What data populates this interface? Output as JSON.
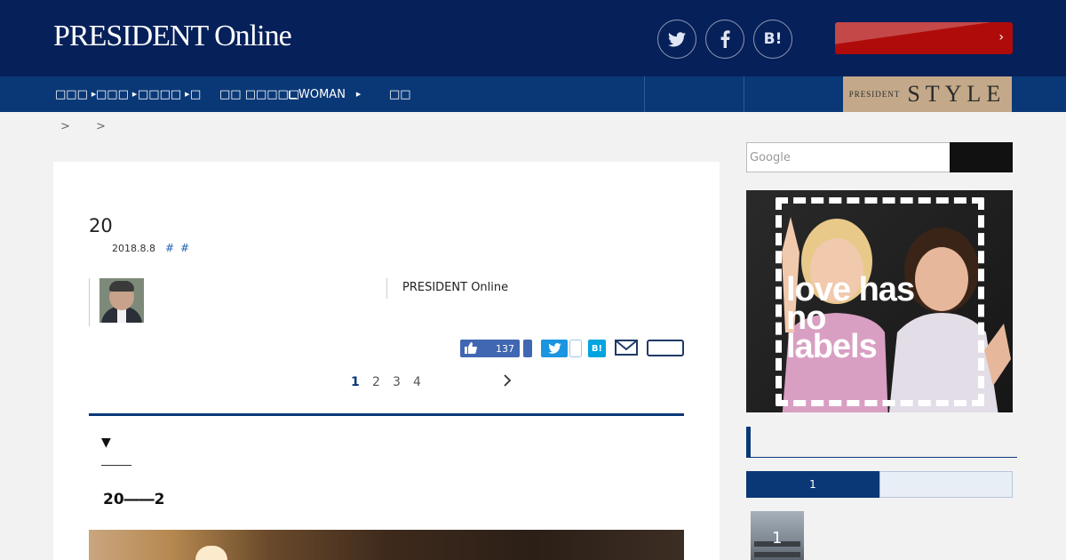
{
  "header": {
    "logo": "PRESIDENT Online",
    "social": [
      "twitter-icon",
      "facebook-icon",
      "hatena-bookmark-icon"
    ],
    "hatena_label": "B!",
    "cta_label": ""
  },
  "nav": {
    "items": [
      {
        "label": "□□□",
        "has_arrow": true
      },
      {
        "label": "□□□",
        "has_arrow": true
      },
      {
        "label": "□□□□",
        "has_arrow": true
      },
      {
        "label": "□",
        "has_arrow": false
      },
      {
        "label": "□□ □□□□□",
        "has_arrow": false
      },
      {
        "label": "WOMAN",
        "has_arrow": true
      },
      {
        "label": "□□",
        "has_arrow": false
      }
    ],
    "style_small": "PRESIDENT",
    "style_big": "STYLE"
  },
  "breadcrumb": [
    ">",
    ">"
  ],
  "article": {
    "title": "20",
    "date": "2018.8.8",
    "tags": [
      "#",
      "#"
    ],
    "publisher": "PRESIDENT Online",
    "like_count": "137",
    "hatena_label": "B!",
    "pages": [
      "1",
      "2",
      "3",
      "4"
    ],
    "current_page": "1",
    "toc_toggle": "▼",
    "subheading": "20――2"
  },
  "sidebar": {
    "search_placeholder": "Google",
    "ad_text": "love has no labels",
    "ranking_tab_active": "1",
    "ranking_first_number": "1"
  },
  "colors": {
    "header_bg": "#06205a",
    "nav_bg": "#0a3877",
    "cta_red": "#b00b0b",
    "style_gold": "#c3a98a",
    "facebook_blue": "#4167b2",
    "twitter_blue": "#1b95e0",
    "hatena_blue": "#00a4de"
  }
}
